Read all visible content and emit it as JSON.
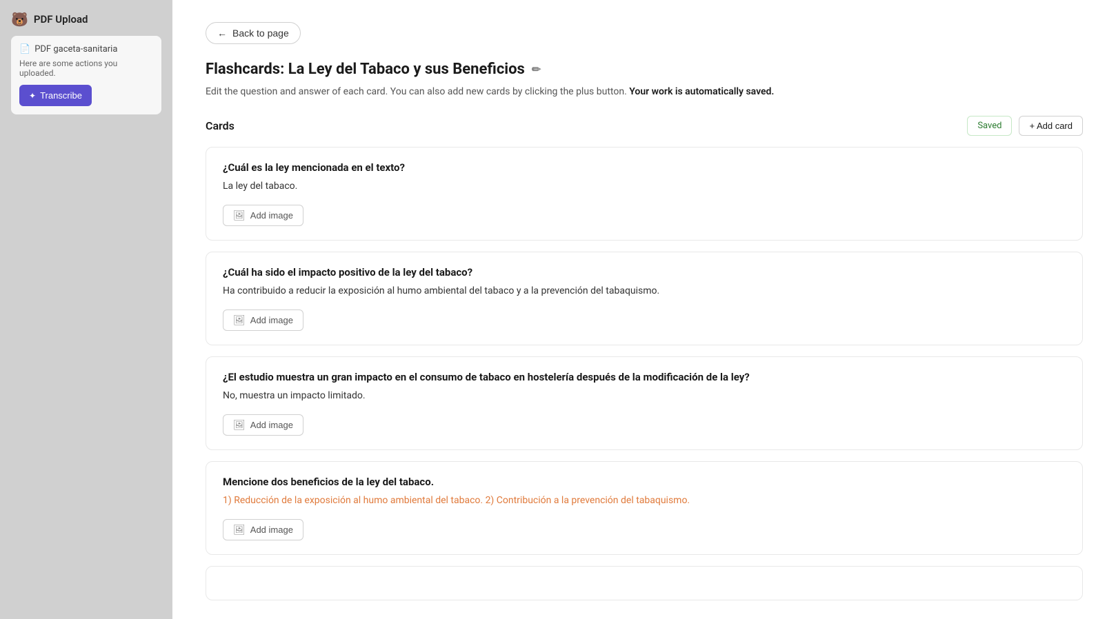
{
  "app": {
    "title": "PDF Upload",
    "bear_emoji": "🐻"
  },
  "sidebar": {
    "title": "PDF Up",
    "file": {
      "name": "PDF gaceta-sanitaria",
      "description": "Here are some actions you uploaded."
    },
    "transcribe_button": "Transcribe",
    "sparkle": "✦"
  },
  "main": {
    "back_button": "Back to page",
    "page_title": "Flashcards: La Ley del Tabaco y sus Beneficios",
    "edit_icon": "✏",
    "subtitle_text": "Edit the question and answer of each card. You can also add new cards by clicking the plus button.",
    "subtitle_bold": "Your work is automatically saved.",
    "cards_label": "Cards",
    "saved_badge": "Saved",
    "add_card_button": "+ Add card",
    "add_image_label": "Add image",
    "cards": [
      {
        "question": "¿Cuál es la ley mencionada en el texto?",
        "answer": "La ley del tabaco.",
        "highlighted": false
      },
      {
        "question": "¿Cuál ha sido el impacto positivo de la ley del tabaco?",
        "answer": "Ha contribuido a reducir la exposición al humo ambiental del tabaco y a la prevención del tabaquismo.",
        "highlighted": false
      },
      {
        "question": "¿El estudio muestra un gran impacto en el consumo de tabaco en hostelería después de la modificación de la ley?",
        "answer": "No, muestra un impacto limitado.",
        "highlighted": false
      },
      {
        "question": "Mencione dos beneficios de la ley del tabaco.",
        "answer": "1) Reducción de la exposición al humo ambiental del tabaco. 2) Contribución a la prevención del tabaquismo.",
        "highlighted": true
      }
    ]
  }
}
